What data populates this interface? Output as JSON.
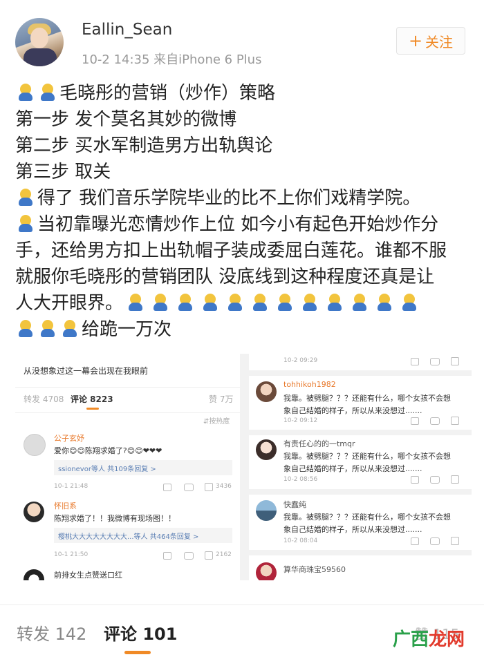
{
  "header": {
    "username": "Eallin_Sean",
    "meta": "10-2 14:35  来自iPhone 6 Plus",
    "follow_label": "关注",
    "follow_icon": "plus-icon"
  },
  "post": {
    "line1": "毛晓彤的营销（炒作）策略",
    "line2": "第一步 发个莫名其妙的微博",
    "line3": "第二步 买水军制造男方出轨舆论",
    "line4": "第三步 取关",
    "line5": "得了 我们音乐学院毕业的比不上你们戏精学院。",
    "line6": "当初靠曝光恋情炒作上位 如今小有起色开始炒作分",
    "line7": "手，还给男方扣上出轨帽子装成委屈白莲花。谁都不服",
    "line8": "就服你毛晓彤的营销团队 没底线到这种程度还真是让",
    "line9": "人大开眼界。",
    "line10": "给跪一万次",
    "emoji_name": "sweat-kneel-emoji"
  },
  "screenshot": {
    "left": {
      "top_text": "从没想象过这一幕会出现在我眼前",
      "repost_tab": "转发 4708",
      "comment_tab": "评论 8223",
      "likes_tab": "赞 7万",
      "sort_label": "按热度",
      "comments": [
        {
          "user": "公子玄妤",
          "text": "爱你😊😊陈翔求婚了?😊😊❤❤❤",
          "reply_users": "ssionevor等人",
          "reply_count": "共109条回复 >",
          "time": "10-1 21:48",
          "likes": "3436"
        },
        {
          "user": "怀旧系",
          "text": "陈翔求婚了！！我微博有现场图！！",
          "reply_users": "樱桃大大大大大大大大...等人",
          "reply_count": "共464条回复 >",
          "time": "10-1 21:50",
          "likes": "2162"
        },
        {
          "text": "前排女生点赞送口红"
        }
      ]
    },
    "right": {
      "top_time": "10-2 09:29",
      "comments": [
        {
          "user": "tohhikoh1982",
          "line1": "我靠。被劈腿？？？还能有什么，哪个女孩不会想",
          "line2": "象自己结婚的样子，所以从来没想过.......",
          "time": "10-2 09:12"
        },
        {
          "user": "有责任心的的一tmqr",
          "line1": "我靠。被劈腿？？？还能有什么，哪个女孩不会想",
          "line2": "象自己结婚的样子，所以从来没想过.......",
          "time": "10-2 08:56"
        },
        {
          "user": "快蠢纯",
          "line1": "我靠。被劈腿？？？还能有什么，哪个女孩不会想",
          "line2": "象自己结婚的样子，所以从来没想过.......",
          "time": "10-2 08:04"
        },
        {
          "user": "算华商珠宝59560"
        }
      ]
    }
  },
  "bottom": {
    "repost": "转发 142",
    "comment": "评论 101",
    "like": "赞 115"
  },
  "watermark": {
    "part1": "广西",
    "part2": "龙网"
  },
  "colors": {
    "accent": "#f08a26",
    "heart": "#e03b3b"
  }
}
